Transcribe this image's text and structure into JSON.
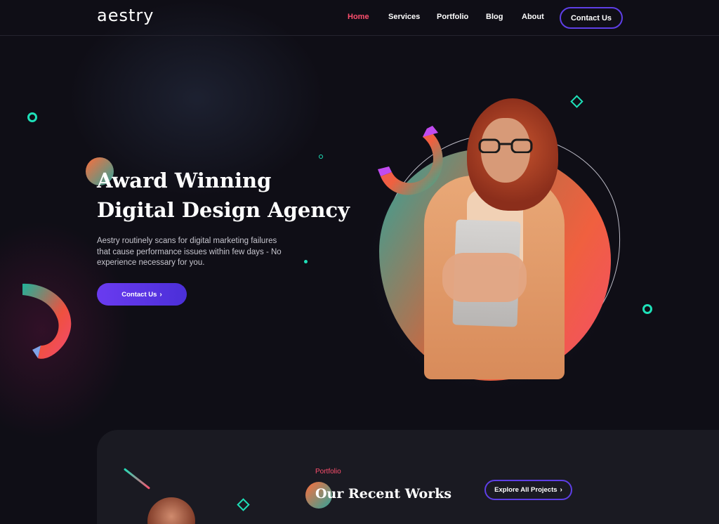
{
  "brand": {
    "logo": "aestry"
  },
  "nav": {
    "items": [
      "Home",
      "Services",
      "Portfolio",
      "Blog",
      "About"
    ],
    "active": "Home",
    "cta": "Contact Us"
  },
  "hero": {
    "title_line1": "Award Winning",
    "title_line2": "Digital Design Agency",
    "description": "Aestry routinely scans for digital marketing failures that cause performance issues within few days - No experience necessary for you.",
    "cta": "Contact Us"
  },
  "portfolio": {
    "label": "Portfolio",
    "title": "Our Recent Works",
    "cta": "Explore All Projects"
  },
  "colors": {
    "background": "#0f0e16",
    "accent_purple": "#5e3fe6",
    "accent_pink": "#ff4f6e",
    "accent_teal": "#1ee0b8"
  },
  "icons": {
    "chevron": "chevron-right-icon"
  }
}
